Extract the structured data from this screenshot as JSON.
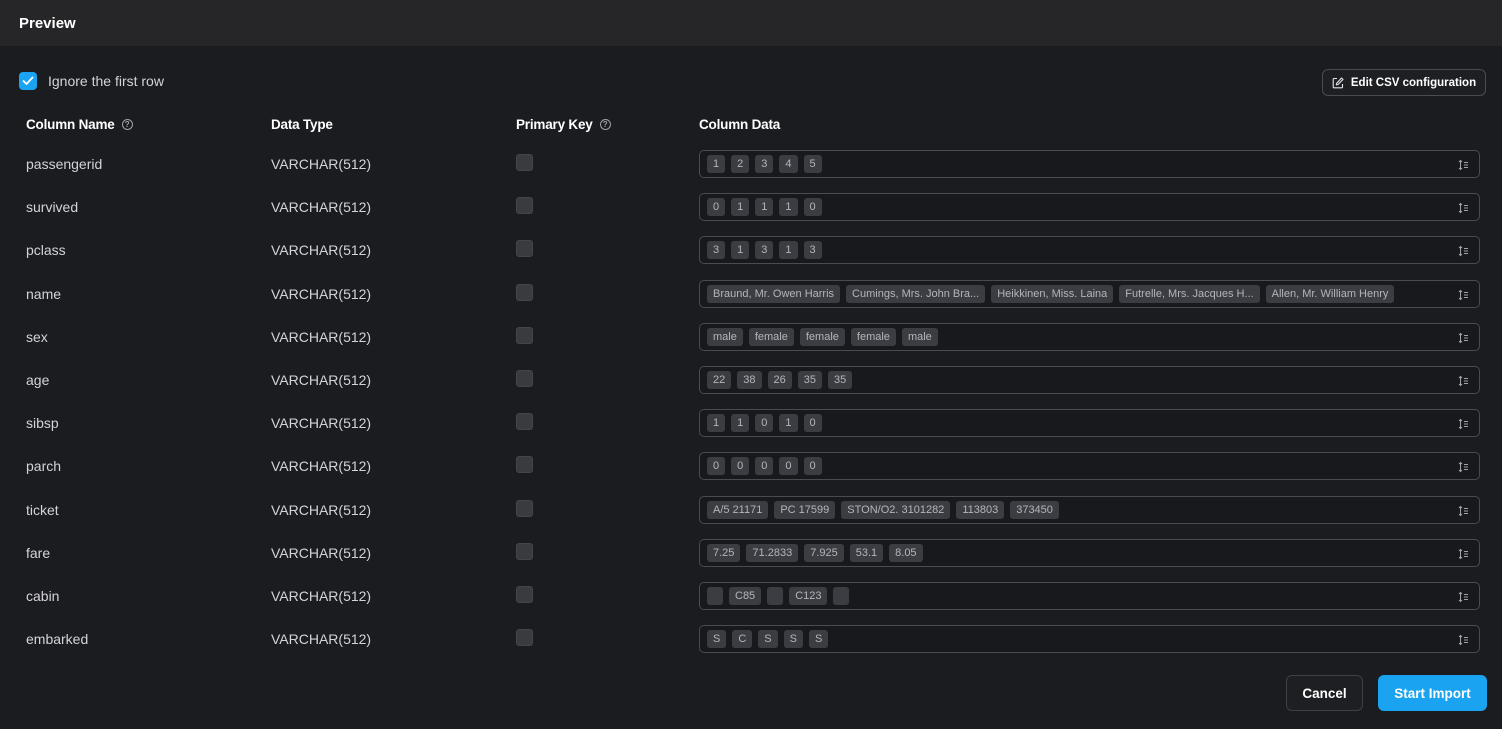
{
  "header": {
    "title": "Preview"
  },
  "options": {
    "ignore_first_row_label": "Ignore the first row",
    "ignore_first_row_checked": true
  },
  "toolbar": {
    "edit_csv_label": "Edit CSV configuration"
  },
  "table": {
    "headers": {
      "column_name": "Column Name",
      "data_type": "Data Type",
      "primary_key": "Primary Key",
      "column_data": "Column Data"
    },
    "rows": [
      {
        "name": "passengerid",
        "type": "VARCHAR(512)",
        "primary_key": false,
        "values": [
          "1",
          "2",
          "3",
          "4",
          "5"
        ]
      },
      {
        "name": "survived",
        "type": "VARCHAR(512)",
        "primary_key": false,
        "values": [
          "0",
          "1",
          "1",
          "1",
          "0"
        ]
      },
      {
        "name": "pclass",
        "type": "VARCHAR(512)",
        "primary_key": false,
        "values": [
          "3",
          "1",
          "3",
          "1",
          "3"
        ]
      },
      {
        "name": "name",
        "type": "VARCHAR(512)",
        "primary_key": false,
        "values": [
          "Braund, Mr. Owen Harris",
          "Cumings, Mrs. John Bra...",
          "Heikkinen, Miss. Laina",
          "Futrelle, Mrs. Jacques H...",
          "Allen, Mr. William Henry"
        ]
      },
      {
        "name": "sex",
        "type": "VARCHAR(512)",
        "primary_key": false,
        "values": [
          "male",
          "female",
          "female",
          "female",
          "male"
        ]
      },
      {
        "name": "age",
        "type": "VARCHAR(512)",
        "primary_key": false,
        "values": [
          "22",
          "38",
          "26",
          "35",
          "35"
        ]
      },
      {
        "name": "sibsp",
        "type": "VARCHAR(512)",
        "primary_key": false,
        "values": [
          "1",
          "1",
          "0",
          "1",
          "0"
        ]
      },
      {
        "name": "parch",
        "type": "VARCHAR(512)",
        "primary_key": false,
        "values": [
          "0",
          "0",
          "0",
          "0",
          "0"
        ]
      },
      {
        "name": "ticket",
        "type": "VARCHAR(512)",
        "primary_key": false,
        "values": [
          "A/5 21171",
          "PC 17599",
          "STON/O2. 3101282",
          "113803",
          "373450"
        ]
      },
      {
        "name": "fare",
        "type": "VARCHAR(512)",
        "primary_key": false,
        "values": [
          "7.25",
          "71.2833",
          "7.925",
          "53.1",
          "8.05"
        ]
      },
      {
        "name": "cabin",
        "type": "VARCHAR(512)",
        "primary_key": false,
        "values": [
          "",
          "C85",
          "",
          "C123",
          ""
        ]
      },
      {
        "name": "embarked",
        "type": "VARCHAR(512)",
        "primary_key": false,
        "values": [
          "S",
          "C",
          "S",
          "S",
          "S"
        ]
      }
    ]
  },
  "footer": {
    "cancel_label": "Cancel",
    "start_label": "Start Import"
  },
  "colors": {
    "accent": "#1aa3f0",
    "background": "#1b1c20",
    "topbar": "#262628",
    "chip": "#3c3d42"
  },
  "icons": {
    "checkbox": "check-icon",
    "edit": "edit-icon",
    "help": "help-circle-icon",
    "sort": "sort-icon"
  }
}
